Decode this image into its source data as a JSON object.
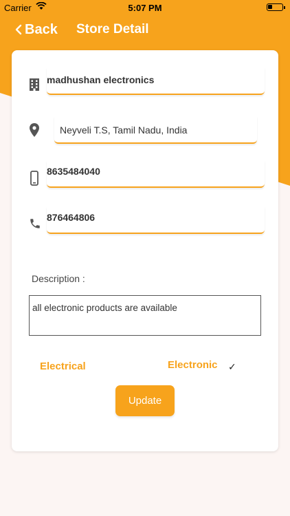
{
  "status_bar": {
    "carrier": "Carrier",
    "time": "5:07 PM"
  },
  "nav": {
    "back_label": "Back",
    "title": "Store Detail"
  },
  "store": {
    "name": "madhushan electronics",
    "address": "Neyveli T.S, Tamil Nadu, India",
    "mobile": "8635484040",
    "phone": "876464806"
  },
  "description": {
    "label": "Description :",
    "value": "all electronic products are available"
  },
  "categories": [
    {
      "label": "Electrical",
      "selected": false
    },
    {
      "label": "Electronic",
      "selected": true
    }
  ],
  "check_mark": "✓",
  "update_label": "Update",
  "colors": {
    "accent": "#f7a31c",
    "background": "#fcf5f3",
    "card": "#ffffff"
  }
}
